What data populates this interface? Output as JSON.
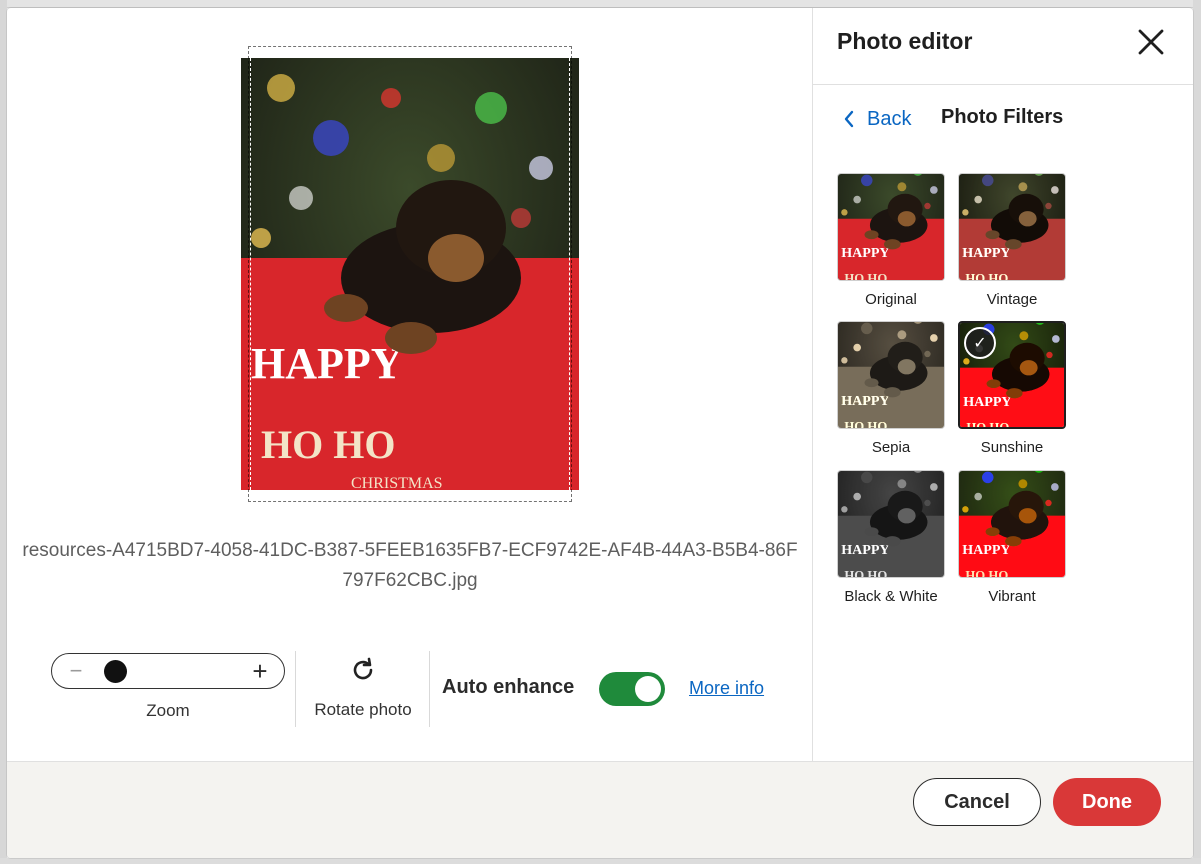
{
  "dialog": {
    "title": "Photo editor",
    "close_icon": "close-icon"
  },
  "preview": {
    "filename": "resources-A4715BD7-4058-41DC-B387-5FEEB1635FB7-ECF9742E-AF4B-44A3-B5B4-86F797F62CBC.jpg"
  },
  "controls": {
    "zoom_label": "Zoom",
    "zoom_level": 0.15,
    "rotate_label": "Rotate photo",
    "auto_enhance_label": "Auto enhance",
    "auto_enhance_on": true,
    "more_info": "More info",
    "toggle_color": "#1f8a3b"
  },
  "filters_panel": {
    "back_label": "Back",
    "title": "Photo Filters",
    "selected": "Sunshine",
    "items": [
      {
        "label": "Original",
        "filter": "none"
      },
      {
        "label": "Vintage",
        "filter": "sepia(0.35) contrast(1.1) saturate(0.9)"
      },
      {
        "label": "Sepia",
        "filter": "sepia(1) saturate(0.8)"
      },
      {
        "label": "Sunshine",
        "filter": "saturate(1.4) contrast(1.1) brightness(1.05)"
      },
      {
        "label": "Black & White",
        "filter": "grayscale(1)"
      },
      {
        "label": "Vibrant",
        "filter": "saturate(1.7)"
      }
    ]
  },
  "footer": {
    "cancel_label": "Cancel",
    "done_label": "Done",
    "done_color": "#d93838"
  }
}
